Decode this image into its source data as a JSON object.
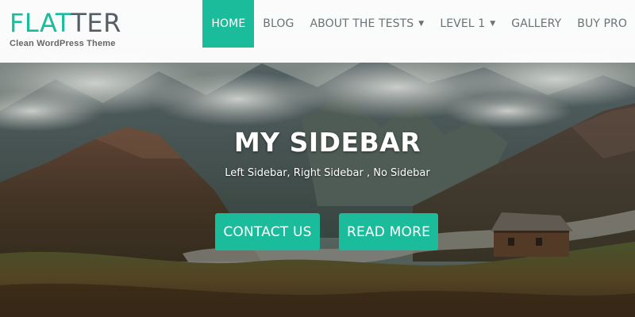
{
  "site": {
    "logo_accent": "FLAT",
    "logo_rest": "TER",
    "tagline": "Clean WordPress Theme"
  },
  "nav": {
    "items": [
      {
        "label": "HOME",
        "active": true
      },
      {
        "label": "BLOG"
      },
      {
        "label": "ABOUT THE TESTS",
        "dropdown": true
      },
      {
        "label": "LEVEL 1",
        "dropdown": true
      },
      {
        "label": "GALLERY"
      },
      {
        "label": "BUY PRO"
      }
    ],
    "dropdown_icon": "caret-down-icon"
  },
  "hero": {
    "title": "MY SIDEBAR",
    "subtitle": "Left Sidebar, Right Sidebar , No Sidebar",
    "buttons": {
      "contact": "CONTACT US",
      "read_more": "READ MORE"
    }
  },
  "colors": {
    "accent": "#1abc9c",
    "nav_text": "#6b7275",
    "logo_rest": "#555e63"
  }
}
